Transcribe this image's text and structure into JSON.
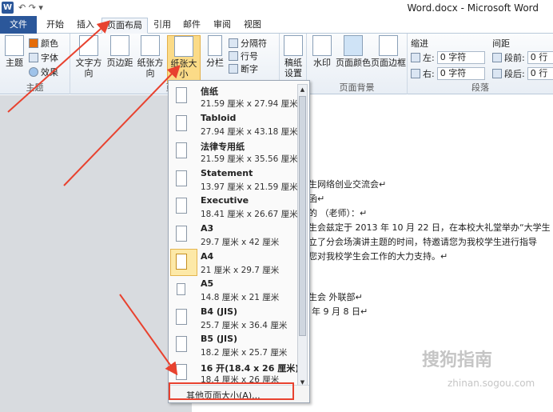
{
  "window": {
    "title": "Word.docx - Microsoft Word"
  },
  "quick_access": {
    "app_icon": "W",
    "glyphs": "↶ ↷ ▾"
  },
  "tabs": [
    {
      "label": "文件"
    },
    {
      "label": "开始"
    },
    {
      "label": "插入"
    },
    {
      "label": "页面布局"
    },
    {
      "label": "引用"
    },
    {
      "label": "邮件"
    },
    {
      "label": "审阅"
    },
    {
      "label": "视图"
    }
  ],
  "ribbon": {
    "theme_group": {
      "label": "主题",
      "theme_btn": "主题",
      "colors": "颜色",
      "fonts": "字体",
      "effects": "效果"
    },
    "page_setup": {
      "label": "页面",
      "text_direction": "文字方向",
      "margins": "页边距",
      "orientation": "纸张方向",
      "size": "纸张大小",
      "columns": "分栏",
      "breaks": "分隔符",
      "line_numbers": "行号",
      "hyphenation": "断字"
    },
    "manuscript": {
      "label1": "稿纸",
      "label2": "设置"
    },
    "page_background": {
      "label": "页面背景",
      "watermark": "水印",
      "page_color": "页面颜色",
      "page_borders": "页面边框"
    },
    "paragraph": {
      "label": "段落",
      "indent_title": "缩进",
      "spacing_title": "间距",
      "left_label": "左:",
      "left_value": "0 字符",
      "right_label": "右:",
      "right_value": "0 字符",
      "before_label": "段前:",
      "before_value": "0 行",
      "after_label": "段后:",
      "after_value": "0 行"
    }
  },
  "paper_sizes": [
    {
      "name": "信纸",
      "size": "21.59 厘米 x 27.94 厘米"
    },
    {
      "name": "Tabloid",
      "size": "27.94 厘米 x 43.18 厘米"
    },
    {
      "name": "法律专用纸",
      "size": "21.59 厘米 x 35.56 厘米"
    },
    {
      "name": "Statement",
      "size": "13.97 厘米 x 21.59 厘米"
    },
    {
      "name": "Executive",
      "size": "18.41 厘米 x 26.67 厘米"
    },
    {
      "name": "A3",
      "size": "29.7 厘米 x 42 厘米"
    },
    {
      "name": "A4",
      "size": "21 厘米 x 29.7 厘米"
    },
    {
      "name": "A5",
      "size": "14.8 厘米 x 21 厘米"
    },
    {
      "name": "B4 (JIS)",
      "size": "25.7 厘米 x 36.4 厘米"
    },
    {
      "name": "B5 (JIS)",
      "size": "18.2 厘米 x 25.7 厘米"
    },
    {
      "name": "16 开(18.4 x 26 厘米)",
      "size": "18.4 厘米 x 26 厘米"
    }
  ],
  "selected_size": "A4",
  "more_sizes": "其他页面大小(A)...",
  "document_lines": [
    "生网络创业交流会↵",
    "函↵",
    "的          （老师）：↵",
    "生会兹定于 2013 年 10 月 22 日，在本校大礼堂举办“大学生",
    "立了分会场演讲主题的时间，特邀请您为我校学生进行指导",
    "您对我校学生会工作的大力支持。↵",
    "生会  外联部↵",
    "年 9 月 8 日↵"
  ],
  "watermark": {
    "text": "搜狗指南",
    "url": "zhinan.sogou.com"
  },
  "annotation_color": "#e8422f"
}
